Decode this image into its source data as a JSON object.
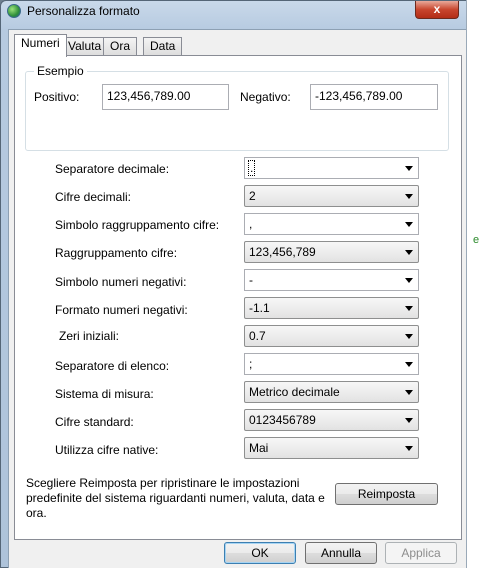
{
  "window": {
    "title": "Personalizza formato",
    "close_glyph": "x"
  },
  "tabs": [
    {
      "label": "Numeri",
      "active": true
    },
    {
      "label": "Valuta",
      "active": false
    },
    {
      "label": "Ora",
      "active": false
    },
    {
      "label": "Data",
      "active": false
    }
  ],
  "example": {
    "legend": "Esempio",
    "positive_label": "Positivo:",
    "positive_value": "123,456,789.00",
    "negative_label": "Negativo:",
    "negative_value": "-123,456,789.00"
  },
  "settings": [
    {
      "label": "Separatore decimale:",
      "value": ".",
      "control": "editable-combo"
    },
    {
      "label": "Cifre decimali:",
      "value": "2",
      "control": "combo"
    },
    {
      "label": "Simbolo raggruppamento cifre:",
      "value": ",",
      "control": "editable-combo"
    },
    {
      "label": "Raggruppamento cifre:",
      "value": "123,456,789",
      "control": "combo"
    },
    {
      "label": "Simbolo numeri negativi:",
      "value": "-",
      "control": "editable-combo"
    },
    {
      "label": "Formato numeri negativi:",
      "value": "-1.1",
      "control": "combo"
    },
    {
      "label": "Zeri iniziali:",
      "value": "0.7",
      "control": "combo"
    },
    {
      "label": "Separatore di elenco:",
      "value": ";",
      "control": "editable-combo"
    },
    {
      "label": "Sistema di misura:",
      "value": "Metrico decimale",
      "control": "combo"
    },
    {
      "label": "Cifre standard:",
      "value": "0123456789",
      "control": "combo"
    },
    {
      "label": "Utilizza cifre native:",
      "value": "Mai",
      "control": "combo"
    }
  ],
  "reset": {
    "text": "Scegliere Reimposta per ripristinare le impostazioni predefinite del sistema riguardanti numeri, valuta, data e ora.",
    "button_label": "Reimposta"
  },
  "footer": {
    "ok_label": "OK",
    "cancel_label": "Annulla",
    "apply_label": "Applica"
  }
}
